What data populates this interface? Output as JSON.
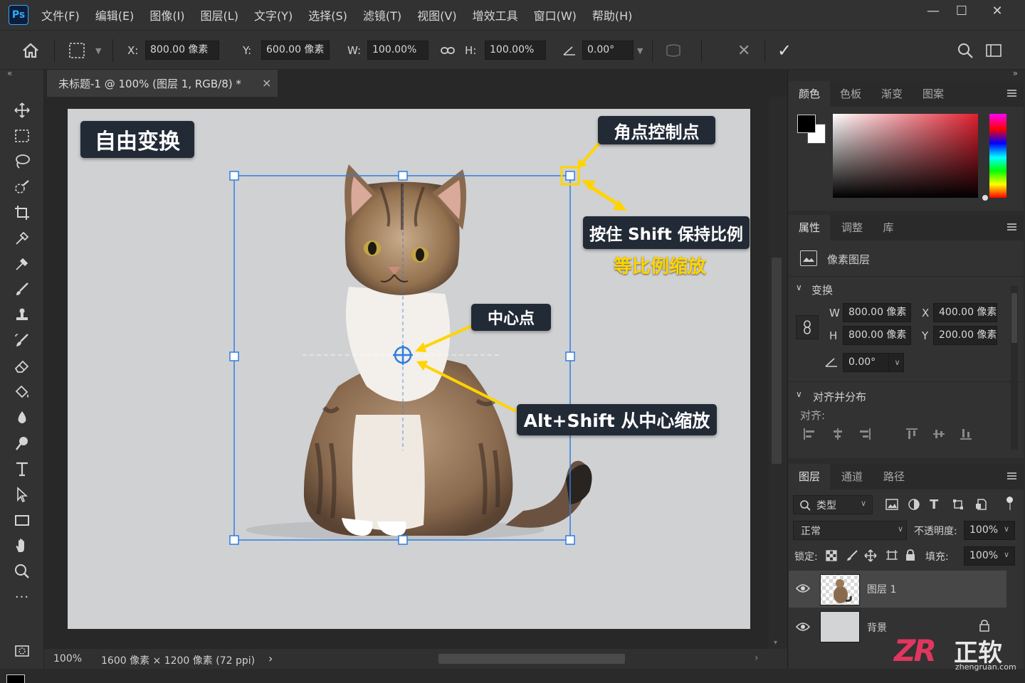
{
  "app": {
    "logo": "Ps"
  },
  "menu": [
    "文件(F)",
    "编辑(E)",
    "图像(I)",
    "图层(L)",
    "文字(Y)",
    "选择(S)",
    "滤镜(T)",
    "视图(V)",
    "增效工具",
    "窗口(W)",
    "帮助(H)"
  ],
  "window_controls": {
    "minimize": "—",
    "maximize": "☐",
    "close": "✕"
  },
  "options": {
    "x_label": "X:",
    "x_value": "800.00 像素",
    "y_label": "Y:",
    "y_value": "600.00 像素",
    "w_label": "W:",
    "w_value": "100.00%",
    "h_label": "H:",
    "h_value": "100.00%",
    "angle_value": "0.00°",
    "cancel": "✕",
    "commit": "✓"
  },
  "document": {
    "tab_title": "未标题-1 @ 100% (图层 1, RGB/8) *",
    "tab_close": "×",
    "zoom": "100%",
    "doc_info": "1600 像素 × 1200 像素 (72 ppi)",
    "info_arrow": "›"
  },
  "annotations": {
    "free_transform": "自由变换",
    "corner_handle": "角点控制点",
    "shift_hint": "按住 Shift 保持比例",
    "proportional": "等比例缩放",
    "center_point": "中心点",
    "alt_shift_hint": "Alt+Shift 从中心缩放"
  },
  "color_panel": {
    "tabs": [
      "颜色",
      "色板",
      "渐变",
      "图案"
    ]
  },
  "properties_panel": {
    "tabs": [
      "属性",
      "调整",
      "库"
    ],
    "layer_type": "像素图层",
    "transform_title": "变换",
    "w_label": "W",
    "w_value": "800.00 像素",
    "h_label": "H",
    "h_value": "800.00 像素",
    "x_label": "X",
    "x_value": "400.00 像素",
    "y_label": "Y",
    "y_value": "200.00 像素",
    "angle_value": "0.00°",
    "align_title": "对齐并分布",
    "align_label": "对齐:"
  },
  "layers_panel": {
    "tabs": [
      "图层",
      "通道",
      "路径"
    ],
    "filter_kind": "类型",
    "blend_mode": "正常",
    "opacity_label": "不透明度:",
    "opacity_value": "100%",
    "lock_label": "锁定:",
    "fill_label": "填充:",
    "fill_value": "100%",
    "layers": [
      {
        "name": "图层 1",
        "selected": true
      },
      {
        "name": "背景",
        "selected": false,
        "locked": true
      }
    ]
  },
  "watermark": {
    "logo": "ZR",
    "brand": "正软",
    "url": "zhengruan.com"
  },
  "colors": {
    "accent_yellow": "#ffd400",
    "transform_box": "#2f7ee0",
    "label_bg": "#222a36",
    "canvas_bg": "#cfd1d3"
  }
}
